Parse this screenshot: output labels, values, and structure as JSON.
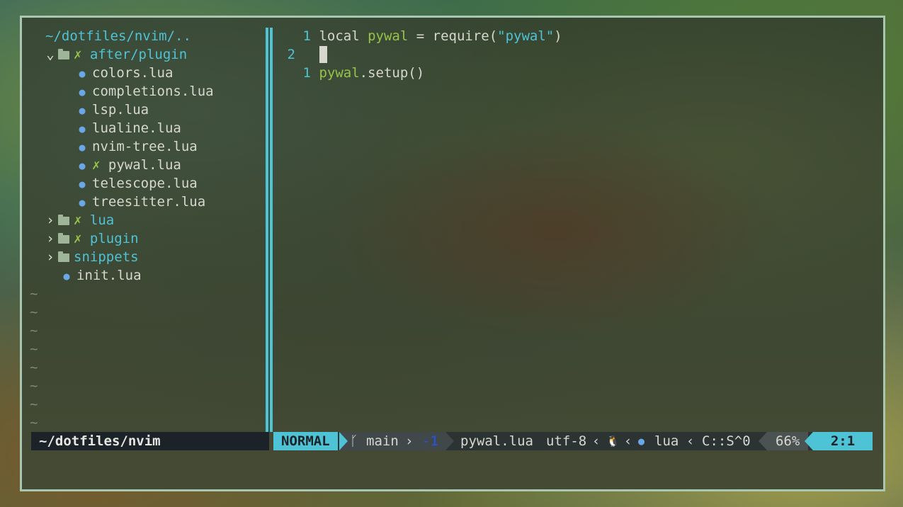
{
  "tree": {
    "root": "~/dotfiles/nvim/..",
    "items": [
      {
        "label": "after/plugin",
        "git": "✗",
        "kind": "dir-open"
      },
      {
        "label": "colors.lua"
      },
      {
        "label": "completions.lua"
      },
      {
        "label": "lsp.lua"
      },
      {
        "label": "lualine.lua"
      },
      {
        "label": "nvim-tree.lua"
      },
      {
        "label": "pywal.lua",
        "git": "✗"
      },
      {
        "label": "telescope.lua"
      },
      {
        "label": "treesitter.lua"
      },
      {
        "label": "lua",
        "git": "✗"
      },
      {
        "label": "plugin",
        "git": "✗"
      },
      {
        "label": "snippets"
      },
      {
        "label": "init.lua"
      }
    ],
    "tilde": "~",
    "footer_path": "~/dotfiles/nvim"
  },
  "editor": {
    "lines": [
      {
        "num": "1",
        "kw": "local",
        "var": "pywal",
        "op": " = require(",
        "str": "\"pywal\"",
        "end": ")"
      },
      {
        "num": "2"
      },
      {
        "num": "1",
        "var": "pywal",
        "rest": ".setup()"
      }
    ]
  },
  "statusline": {
    "mode": "NORMAL",
    "branch_icon": "ᚴ",
    "branch": "main",
    "diff": "-1",
    "filename": "pywal.lua",
    "encoding": "utf-8",
    "os_icon": "🐧",
    "filetype": "lua",
    "lsp": "C::S^0",
    "progress": "66%",
    "position": "2:1"
  }
}
